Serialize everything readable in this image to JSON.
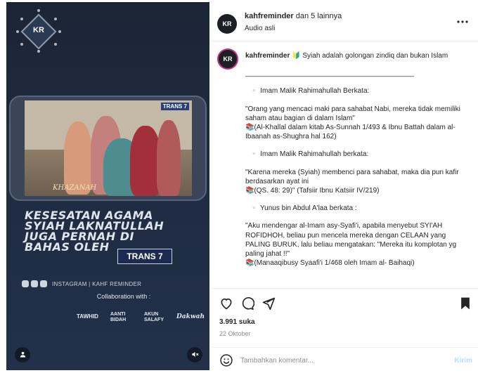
{
  "colors": {
    "video_bg": "#1f2b40",
    "text_primary": "#262626",
    "text_secondary": "#8e8e8e",
    "post_button_disabled": "#b2dffc",
    "story_ring": "#c13584"
  },
  "video": {
    "logo_text": "KR",
    "tv_channel": "TRANS 7",
    "tv_program": "KHAZANAH",
    "headline_lines": [
      "KESESATAN AGAMA",
      "SYIAH LAKNATULLAH",
      "JUGA PERNAH DI",
      "BAHAS  OLEH"
    ],
    "headline_badge": "TRANS 7",
    "social_handle": "INSTAGRAM | KAHF REMINDER",
    "collab_title": "Collaboration with :",
    "partners": [
      "TAWHID",
      "AANTI BIDAH",
      "AKUN SALAFY",
      "Dakwah"
    ],
    "controls": {
      "user_icon": "user-icon",
      "mute_icon": "mute-icon"
    }
  },
  "post": {
    "author": "kahfreminder",
    "coauthors": "dan 5 lainnya",
    "audio": "Audio asli",
    "avatar_text": "KR"
  },
  "caption": {
    "owner": "kahfreminder",
    "title": "🔰 Syiah adalah golongan zindiq dan bukan Islam",
    "rule": "______________________________________________",
    "b1_title": "▫️ Imam Malik Rahimahullah Berkata:",
    "b1_quote": "\"Orang yang mencaci maki para sahabat Nabi, mereka tidak memiliki saham atau bagian di dalam Islam\"",
    "b1_source": "📚(Al-Khallal dalam kitab As-Sunnah 1/493 & Ibnu Battah dalam al-Ibaanah as-Shughra hal 162)",
    "b2_title": "▫️ Imam Malik Rahimahullah berkata:",
    "b2_quote": "\"Karena mereka (Syiah) membenci para sahabat, maka dia pun kafir berdasarkan ayat ini",
    "b2_source": "📚(QS. 48: 29)\" (Tafsiir Ibnu Katsiir IV/219)",
    "b3_title": "▫️ Yunus bin Abdul A'laa berkata :",
    "b3_quote": "\"Aku mendengar al-Imam asy-Syafi'i, apabila menyebut SYI'AH ROFIDHOH, beliau pun mencela mereka dengan CELAAN yang PALING BURUK, lalu beliau mengatakan: \"Mereka itu komplotan yg paling jahat !!\"",
    "b3_source": "📚(Manaaqibusy Syaafi'i 1/468 oleh Imam al- Baihaqi)"
  },
  "actions": {
    "like_icon": "heart-icon",
    "comment_icon": "comment-icon",
    "share_icon": "share-icon",
    "save_icon": "bookmark-icon"
  },
  "stats": {
    "likes": "3.991 suka",
    "date": "22 Oktober"
  },
  "comment": {
    "placeholder": "Tambahkan komentar...",
    "post_label": "Kirim"
  }
}
